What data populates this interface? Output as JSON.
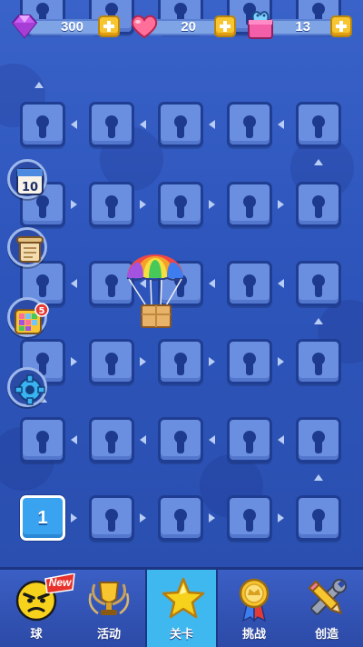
{
  "resources": {
    "gems": {
      "icon": "gem-icon",
      "value": "300"
    },
    "hearts": {
      "icon": "heart-icon",
      "value": "20"
    },
    "boxes": {
      "icon": "gift-box-icon",
      "value": "13"
    }
  },
  "levels": {
    "unlocked_level_label": "1"
  },
  "side_buttons": [
    {
      "name": "calendar-button",
      "icon": "calendar-10-icon",
      "label": "10"
    },
    {
      "name": "scroll-button",
      "icon": "scroll-icon"
    },
    {
      "name": "board-button",
      "icon": "board-icon",
      "badge": "5"
    },
    {
      "name": "settings-button",
      "icon": "gear-icon"
    }
  ],
  "tabs": [
    {
      "label": "球",
      "icon": "angry-ball-icon",
      "badge": "New"
    },
    {
      "label": "活动",
      "icon": "trophy-icon"
    },
    {
      "label": "关卡",
      "icon": "star-icon",
      "active": true
    },
    {
      "label": "挑战",
      "icon": "medal-icon"
    },
    {
      "label": "创造",
      "icon": "pencil-wrench-icon"
    }
  ],
  "colors": {
    "background": "#2d55bb",
    "tile_locked": "#6a8fe0",
    "tile_unlocked": "#3aa3f0",
    "active_tab": "#3fb7ef",
    "plus_button": "#f7c530"
  }
}
